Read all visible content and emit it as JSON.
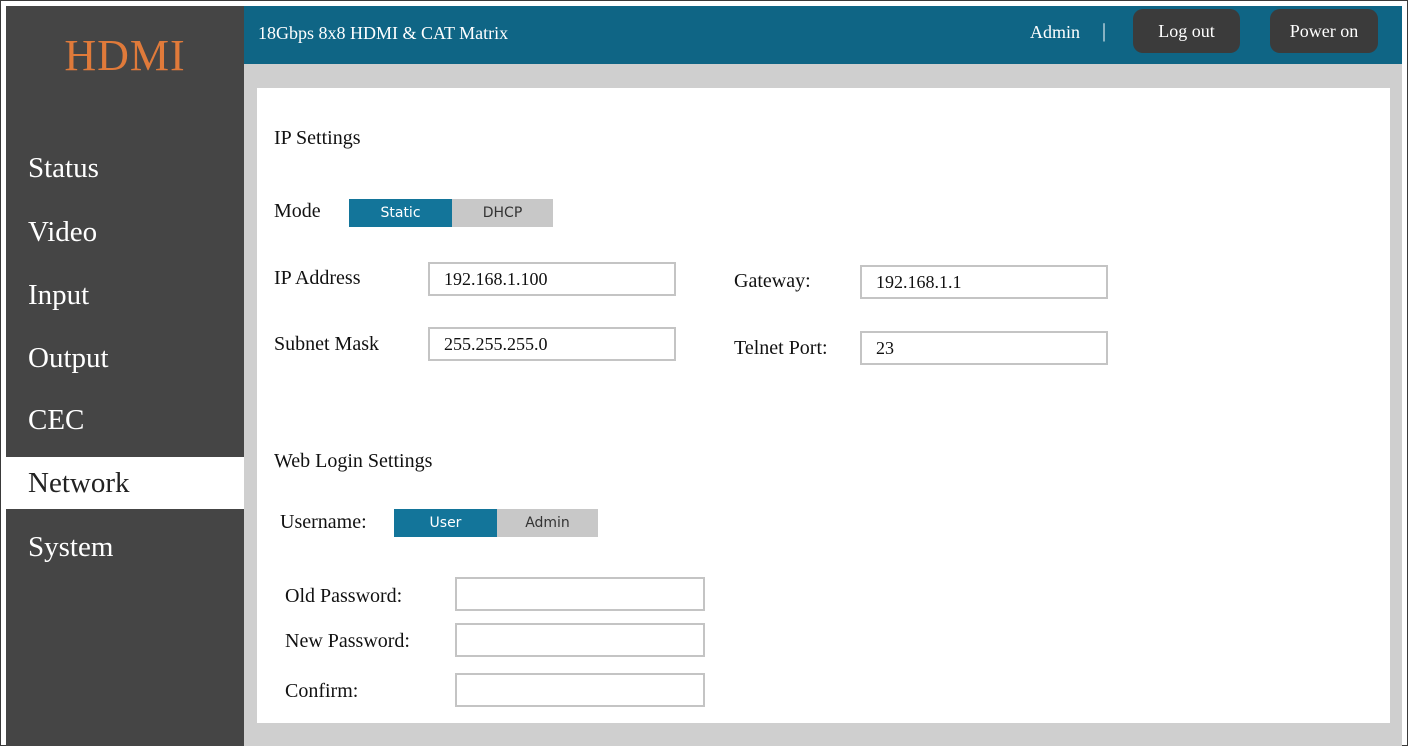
{
  "logo": "HDMI",
  "nav": [
    {
      "label": "Status"
    },
    {
      "label": "Video"
    },
    {
      "label": "Input"
    },
    {
      "label": "Output"
    },
    {
      "label": "CEC"
    },
    {
      "label": "Network",
      "active": true
    },
    {
      "label": "System"
    }
  ],
  "header": {
    "title": "18Gbps 8x8 HDMI & CAT Matrix",
    "user": "Admin",
    "separator": "|",
    "logout_label": "Log out",
    "power_label": "Power on"
  },
  "ip_settings": {
    "heading": "IP Settings",
    "mode_label": "Mode",
    "mode_options": [
      "Static",
      "DHCP"
    ],
    "mode_selected": "Static",
    "ip_label": "IP Address",
    "ip_value": "192.168.1.100",
    "subnet_label": "Subnet Mask",
    "subnet_value": "255.255.255.0",
    "gateway_label": "Gateway:",
    "gateway_value": "192.168.1.1",
    "telnet_label": "Telnet Port:",
    "telnet_value": "23"
  },
  "web_login": {
    "heading": "Web Login Settings",
    "username_label": "Username:",
    "username_options": [
      "User",
      "Admin"
    ],
    "username_selected": "User",
    "old_password_label": "Old Password:",
    "new_password_label": "New Password:",
    "confirm_label": "Confirm:"
  },
  "colors": {
    "header_bg": "#0f6585",
    "sidebar_bg": "#454545",
    "logo": "#e07a3a",
    "accent": "#13759a"
  }
}
